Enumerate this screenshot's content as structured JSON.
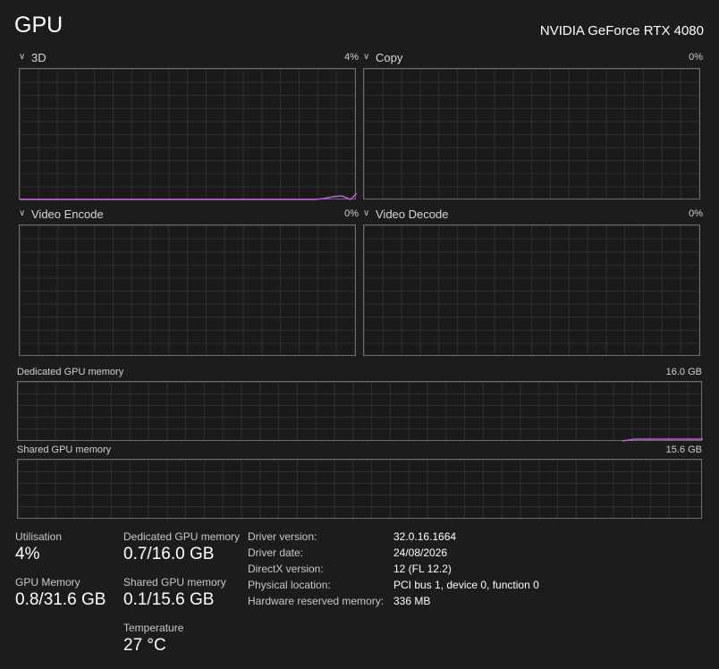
{
  "header": {
    "title": "GPU",
    "gpu_name": "NVIDIA GeForce RTX 4080"
  },
  "engines": [
    {
      "label": "3D",
      "percent": "4%"
    },
    {
      "label": "Copy",
      "percent": "0%"
    },
    {
      "label": "Video Encode",
      "percent": "0%"
    },
    {
      "label": "Video Decode",
      "percent": "0%"
    }
  ],
  "memory_graphs": {
    "dedicated": {
      "label": "Dedicated GPU memory",
      "max": "16.0 GB"
    },
    "shared": {
      "label": "Shared GPU memory",
      "max": "15.6 GB"
    }
  },
  "stats": {
    "utilisation": {
      "label": "Utilisation",
      "value": "4%"
    },
    "gpu_memory": {
      "label": "GPU Memory",
      "value": "0.8/31.6 GB"
    },
    "dedicated": {
      "label": "Dedicated GPU memory",
      "value": "0.7/16.0 GB"
    },
    "shared": {
      "label": "Shared GPU memory",
      "value": "0.1/15.6 GB"
    },
    "temperature": {
      "label": "Temperature",
      "value": "27 °C"
    }
  },
  "details": {
    "driver_version": {
      "label": "Driver version:",
      "value": "32.0.16.1664"
    },
    "driver_date": {
      "label": "Driver date:",
      "value": "24/08/2026"
    },
    "directx": {
      "label": "DirectX version:",
      "value": "12 (FL 12.2)"
    },
    "physical": {
      "label": "Physical location:",
      "value": "PCI bus 1, device 0, function 0"
    },
    "reserved": {
      "label": "Hardware reserved memory:",
      "value": "336 MB"
    }
  },
  "colors": {
    "background": "#1c1c1c",
    "graph_border": "#6e6e6e",
    "grid": "#2f2f2f",
    "line": "#c060d8"
  }
}
